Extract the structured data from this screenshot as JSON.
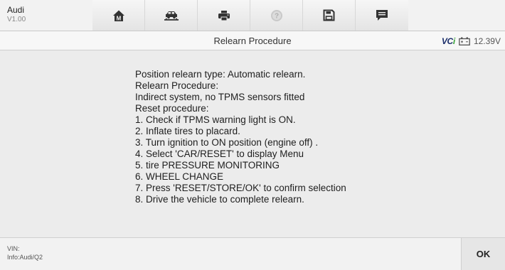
{
  "app": {
    "name": "Audi",
    "version": "V1.00"
  },
  "toolbar": {
    "buttons": [
      {
        "name": "home",
        "icon": "home-icon"
      },
      {
        "name": "vehicle-swap",
        "icon": "car-lift-icon"
      },
      {
        "name": "print",
        "icon": "printer-icon"
      },
      {
        "name": "help",
        "icon": "help-icon",
        "disabled": true
      },
      {
        "name": "save",
        "icon": "save-icon"
      },
      {
        "name": "data-logging",
        "icon": "chat-icon"
      }
    ]
  },
  "header": {
    "title": "Relearn Procedure",
    "vci_prefix": "VC",
    "vci_suffix": "i",
    "battery_icon": "battery-icon",
    "voltage": "12.39V"
  },
  "procedure": {
    "lines": [
      "Position relearn type: Automatic relearn.",
      "Relearn Procedure:",
      "Indirect system, no TPMS sensors fitted",
      "Reset procedure:",
      "1. Check if TPMS warning light is ON.",
      "2. Inflate tires to placard.",
      "3. Turn ignition to ON position (engine off) .",
      "4. Select 'CAR/RESET' to display Menu",
      "5. tire PRESSURE MONITORING",
      "6. WHEEL CHANGE",
      "7. Press 'RESET/STORE/OK' to confirm selection",
      "8. Drive the vehicle to complete relearn."
    ]
  },
  "footer": {
    "vin_label": "VIN:",
    "info_label": "Info:Audi/Q2",
    "ok_label": "OK"
  },
  "colors": {
    "vci_text": "#1c2f6b",
    "vci_accent": "#3aa33a",
    "icon_dark": "#333333",
    "icon_disabled": "#b5b5b5"
  }
}
